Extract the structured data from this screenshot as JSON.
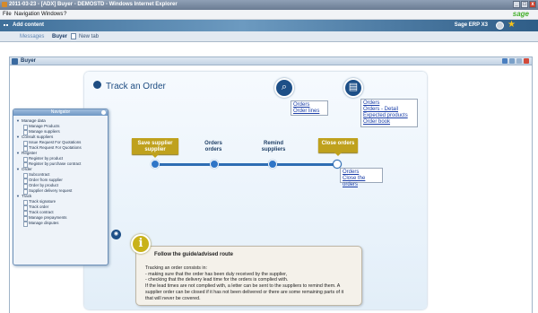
{
  "window": {
    "title": "2011-03-23 - [ADX] Buyer - DEMOSTD - Windows Internet Explorer",
    "controls": [
      "_",
      "□",
      "x"
    ]
  },
  "menu": {
    "items": [
      "File",
      "Navigation",
      "Windows",
      "?"
    ],
    "brand": "sage"
  },
  "appbar": {
    "add_content": "Add content",
    "product": "Sage ERP X3"
  },
  "tabs": {
    "messages": "Messages",
    "buyer": "Buyer",
    "new_tab": "New tab"
  },
  "page": {
    "title": "Buyer"
  },
  "card": {
    "title": "Track an Order",
    "search_links": [
      "Orders",
      "Order lines"
    ],
    "print_links": [
      "Orders",
      "Orders - Detail",
      "Expected products",
      "Order book"
    ]
  },
  "workflow": {
    "steps": [
      {
        "label": "Save supplier supplier",
        "type": "button"
      },
      {
        "label": "Orders orders",
        "type": "text"
      },
      {
        "label": "Remind suppliers",
        "type": "text"
      },
      {
        "label": "Close orders",
        "type": "button"
      }
    ],
    "close_links": [
      "Orders",
      "Close the orders"
    ]
  },
  "info": {
    "title": "Follow the guide/advised route",
    "lines": [
      "Tracking an order consists in:",
      "- making sure that the order has been duly received by the supplier,",
      "- checking that the delivery lead time for the orders is complied with.",
      "If the lead times are not complied with, a letter can be sent to the suppliers to remind them. A",
      "supplier order can be closed if it has not been delivered or there are some remaining parts of it",
      "that will never be covered."
    ]
  },
  "navigator": {
    "title": "Navigator",
    "sections": [
      {
        "label": "Manage data",
        "items": [
          "Manage Products",
          "Manage suppliers"
        ]
      },
      {
        "label": "Consult suppliers",
        "items": [
          "Issue Request For Quotations",
          "Track Request For Quotations"
        ]
      },
      {
        "label": "Register",
        "items": [
          "Register by product",
          "Register by purchase contract"
        ]
      },
      {
        "label": "Order",
        "items": [
          "Subcontract",
          "Order from supplier",
          "Order by product",
          "Supplier delivery request"
        ]
      },
      {
        "label": "Track",
        "items": [
          "Track signature",
          "Track order",
          "Track contract",
          "Manage prepayments",
          "Manage disputes"
        ]
      }
    ]
  },
  "colors": {
    "brand_blue": "#1d4f87",
    "workflow_gold": "#bfa11d",
    "sage_green": "#43b02a"
  }
}
